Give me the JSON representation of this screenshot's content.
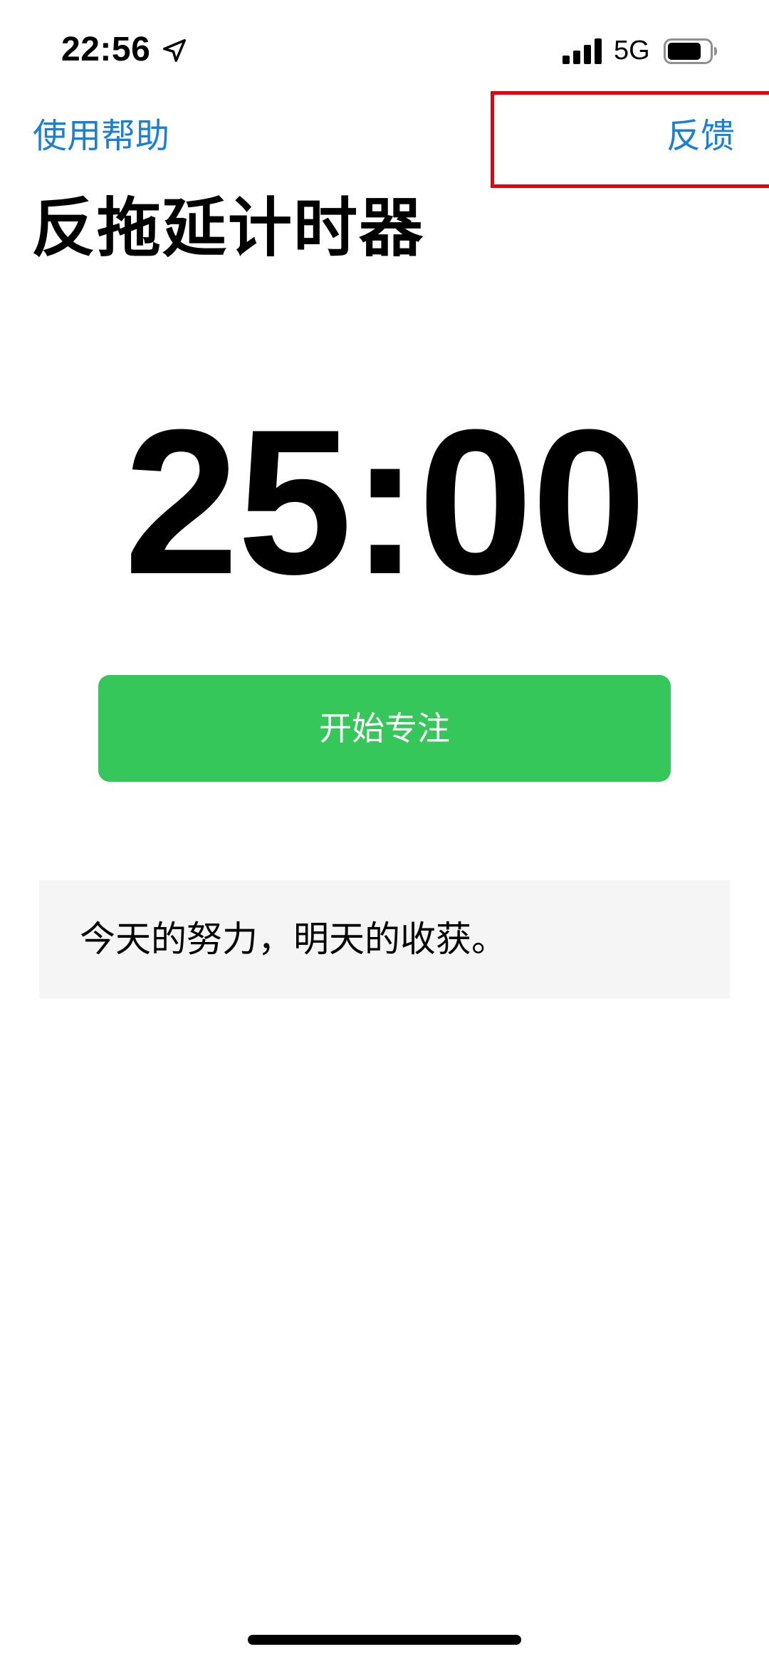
{
  "status_bar": {
    "time": "22:56",
    "location_icon": "location-arrow-icon",
    "signal_icon": "cellular-signal-icon",
    "network": "5G",
    "battery_icon": "battery-icon"
  },
  "nav": {
    "help_label": "使用帮助",
    "feedback_label": "反馈"
  },
  "page": {
    "title": "反拖延计时器"
  },
  "timer": {
    "display": "25:00"
  },
  "actions": {
    "start_label": "开始专注"
  },
  "quote": {
    "text": "今天的努力，明天的收获。"
  },
  "colors": {
    "link": "#1a7fd8",
    "start_button": "#35c75a",
    "highlight": "#e8000e",
    "card_bg": "#f5f5f5"
  }
}
